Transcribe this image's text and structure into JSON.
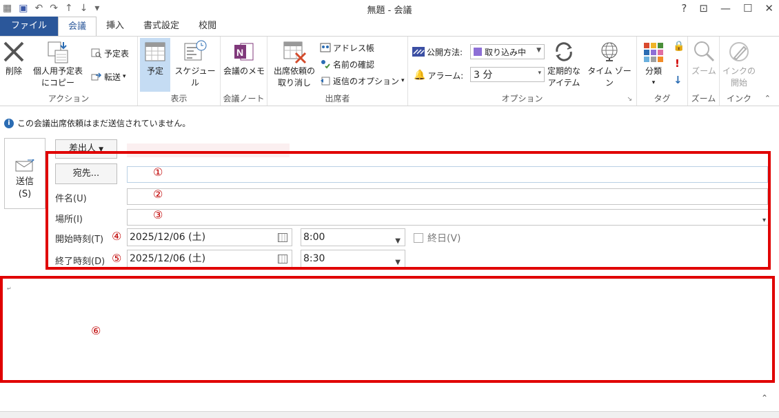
{
  "window": {
    "title": "無題 - 会議",
    "controls": {
      "help": "?",
      "restore_ribbon": "⊡",
      "minimize": "—",
      "maximize": "☐",
      "close": "✕"
    }
  },
  "qat": {
    "undo": "↶",
    "redo": "↷",
    "up": "↑",
    "down": "↓",
    "more": "▾"
  },
  "tabs": [
    {
      "label": "ファイル"
    },
    {
      "label": "会議"
    },
    {
      "label": "挿入"
    },
    {
      "label": "書式設定"
    },
    {
      "label": "校閲"
    }
  ],
  "ribbon": {
    "action": {
      "label": "アクション",
      "delete": "削除",
      "copy_line1": "個人用予定表",
      "copy_line2": "にコピー",
      "calendar": "予定表",
      "forward": "転送"
    },
    "show": {
      "label": "表示",
      "appointment": "予定",
      "schedule": "スケジュール"
    },
    "notes": {
      "label": "会議ノート",
      "meeting_notes": "会議のメモ"
    },
    "attendees": {
      "label": "出席者",
      "cancel_line1": "出席依頼の",
      "cancel_line2": "取り消し",
      "address_book": "アドレス帳",
      "check_names": "名前の確認",
      "response_options": "返信のオプション"
    },
    "options": {
      "label": "オプション",
      "show_as_label": "公開方法:",
      "show_as_value": "取り込み中",
      "reminder_label": "アラーム:",
      "reminder_value": "3 分",
      "recurrence_line1": "定期的な",
      "recurrence_line2": "アイテム",
      "timezone": "タイム ゾーン"
    },
    "tags": {
      "label": "タグ",
      "categorize": "分類"
    },
    "zoom": {
      "label": "ズーム",
      "zoom": "ズーム"
    },
    "ink": {
      "label": "インク",
      "ink_line1": "インクの",
      "ink_line2": "開始"
    }
  },
  "infobar": {
    "text": "この会議出席依頼はまだ送信されていません。"
  },
  "form": {
    "send_line1": "送信",
    "send_line2": "(S)",
    "from_button": "差出人",
    "to_button": "宛先...",
    "subject_label": "件名(U)",
    "location_label": "場所(I)",
    "start_label": "開始時刻(T)",
    "end_label": "終了時刻(D)",
    "start_date": "2025/12/06 (土)",
    "start_time": "8:00",
    "end_date": "2025/12/06 (土)",
    "end_time": "8:30",
    "all_day": "終日(V)"
  },
  "annotations": {
    "n1": "①",
    "n2": "②",
    "n3": "③",
    "n4": "④",
    "n5": "⑤",
    "n6": "⑥"
  },
  "colors": {
    "file_tab": "#2b579a",
    "highlight": "#e00000",
    "show_as_swatch": "#8d6fd6"
  }
}
